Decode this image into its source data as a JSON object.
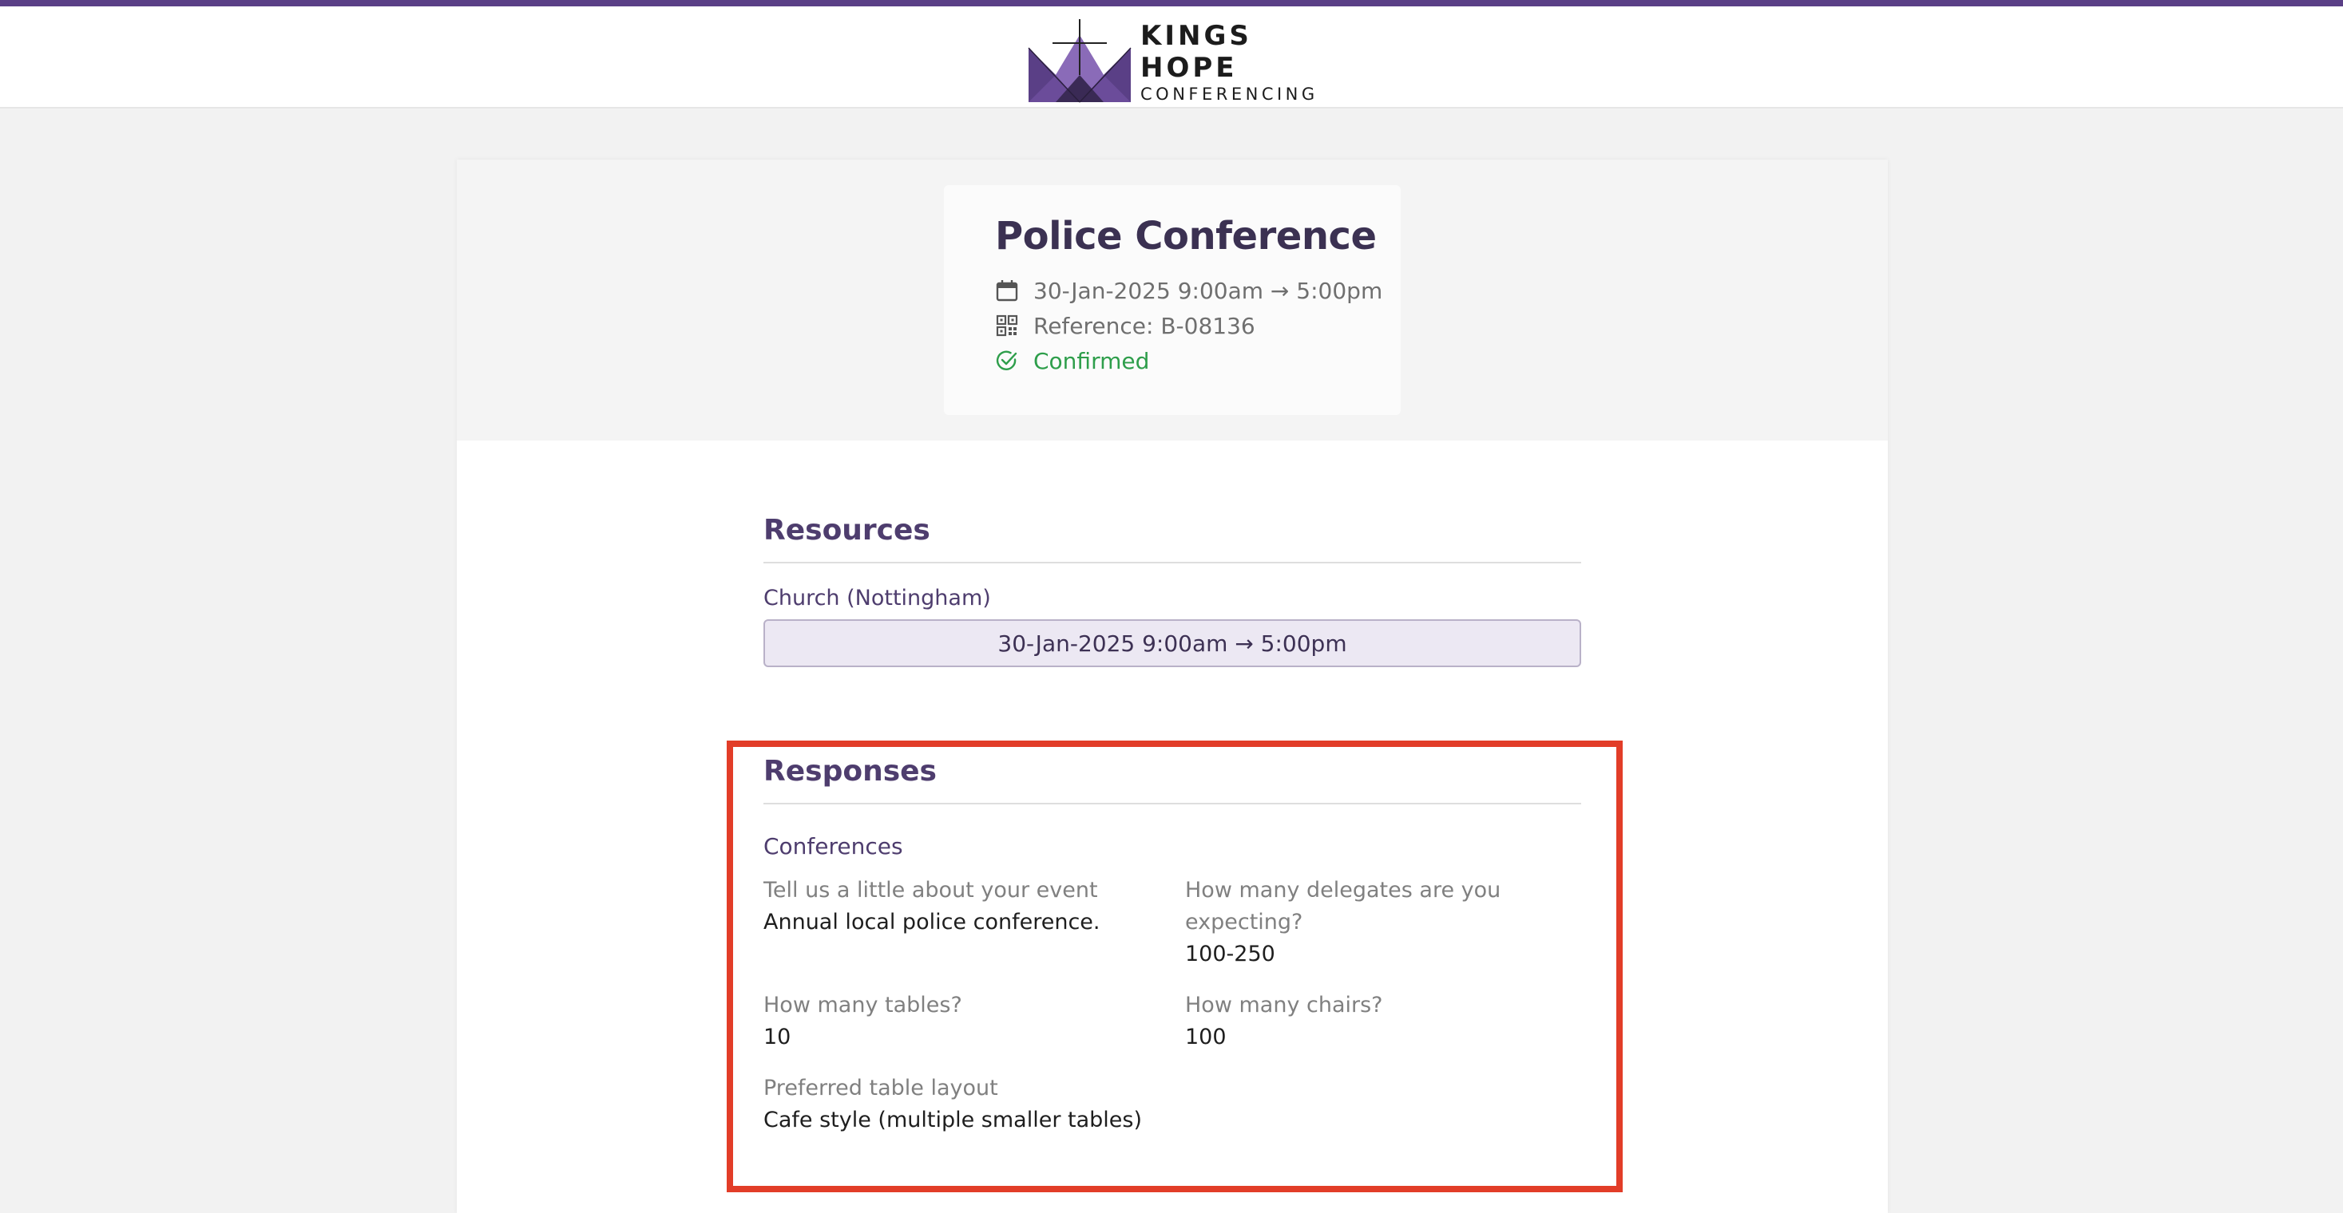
{
  "brand": {
    "name_line1": "KINGS HOPE",
    "name_line2": "CONFERENCING",
    "stripe_color": "#5a3f86",
    "logo_color": "#6b4c9a"
  },
  "event": {
    "title": "Police Conference",
    "datetime": "30-Jan-2025 9:00am → 5:00pm",
    "reference": "Reference: B-08136",
    "status": "Confirmed",
    "status_color": "#2e9e4b",
    "icons": [
      "calendar-icon",
      "qr-code-icon",
      "check-circle-icon"
    ]
  },
  "resources": {
    "title": "Resources",
    "items": [
      {
        "name": "Church (Nottingham)",
        "slot": "30-Jan-2025 9:00am → 5:00pm"
      }
    ]
  },
  "responses": {
    "title": "Responses",
    "group": "Conferences",
    "items": [
      {
        "question": "Tell us a little about your event",
        "answer": "Annual local police conference."
      },
      {
        "question": "How many delegates are you expecting?",
        "answer": "100-250"
      },
      {
        "question": "How many tables?",
        "answer": "10"
      },
      {
        "question": "How many chairs?",
        "answer": "100"
      },
      {
        "question": "Preferred table layout",
        "answer": "Cafe style (multiple smaller tables)"
      }
    ],
    "highlight_color": "#e23d28"
  }
}
